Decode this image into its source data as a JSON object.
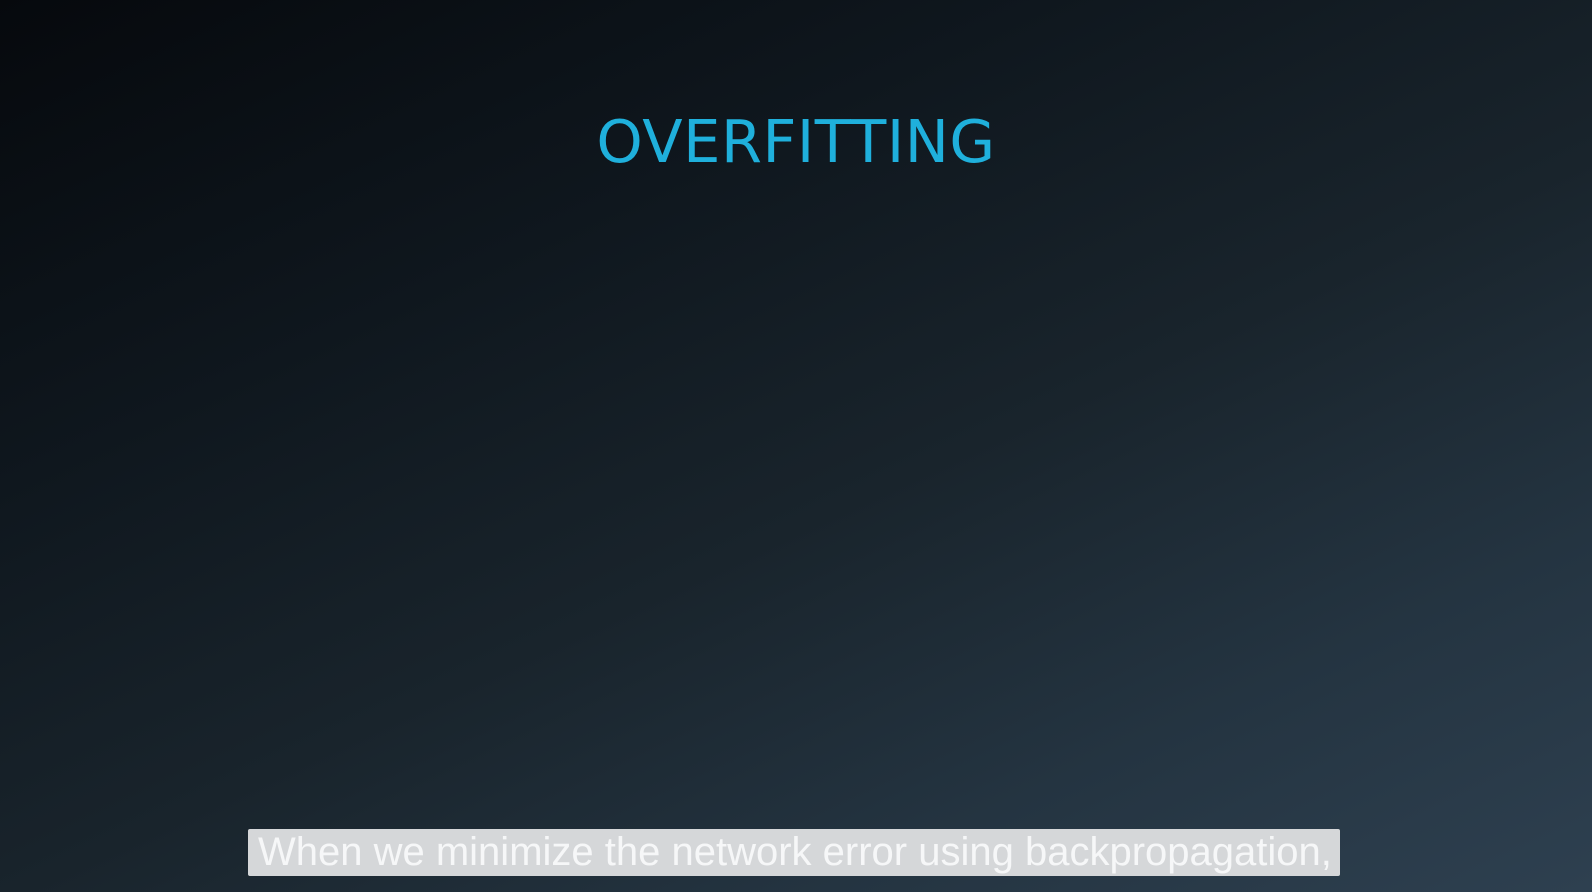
{
  "slide": {
    "title": "OVERFITTING"
  },
  "caption": {
    "text": "When we minimize the network error using backpropagation,"
  },
  "colors": {
    "title": "#1fb0dc",
    "caption_background": "#d5d7d9",
    "caption_text": "#f6f7f8"
  }
}
